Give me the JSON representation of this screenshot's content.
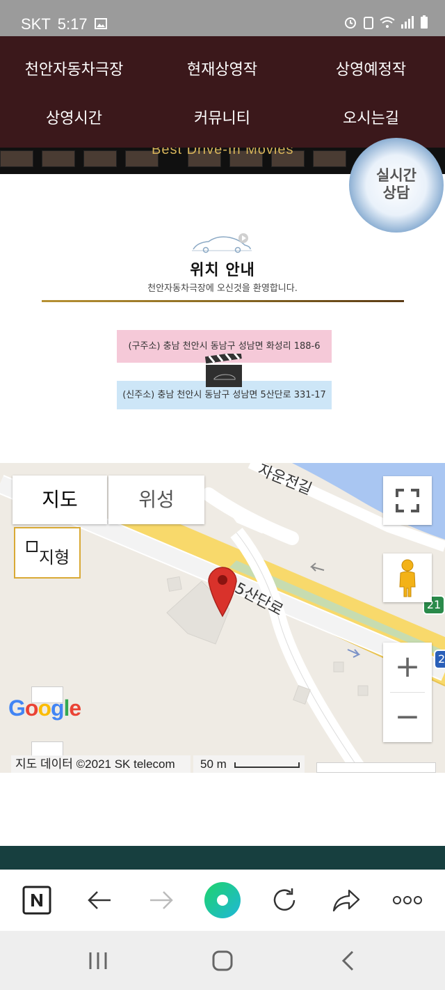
{
  "status_bar": {
    "carrier": "SKT",
    "time": "5:17"
  },
  "nav_menu": [
    {
      "label": "천안자동차극장"
    },
    {
      "label": "현재상영작"
    },
    {
      "label": "상영예정작"
    },
    {
      "label": "상영시간"
    },
    {
      "label": "커뮤니티"
    },
    {
      "label": "오시는길"
    }
  ],
  "hero": {
    "caption": "Best Drive-In Movies"
  },
  "chat_button": {
    "line1": "실시간",
    "line2": "상담"
  },
  "location": {
    "title": "위치 안내",
    "subtitle": "천안자동차극장에 오신것을 환영합니다.",
    "old_address": "(구주소) 충남 천안시 동남구 성남면 화성리 188-6",
    "new_address": "(신주소) 충남 천안시 동남구 성남면 5산단로 331-17"
  },
  "map": {
    "tab_map": "지도",
    "tab_satellite": "위성",
    "terrain_label": "지형",
    "road_label_1": "5산단로",
    "road_label_2": "자운전길",
    "route_badge": "21",
    "route_badge_2": "2",
    "zoom_in": "+",
    "zoom_out": "−",
    "attribution": "지도 데이터 ©2021 SK telecom",
    "scale": "50 m",
    "logo": "Google"
  },
  "browser_bar": {
    "icons": [
      "naver-home-icon",
      "back-arrow-icon",
      "forward-arrow-icon",
      "search-circle-icon",
      "reload-icon",
      "share-icon",
      "more-icon"
    ]
  },
  "android_nav": {
    "icons": [
      "recent-apps-icon",
      "home-icon",
      "back-icon"
    ]
  },
  "colors": {
    "nav_bg": "#3b181b",
    "status_bg": "#9b9b9b",
    "footer_band": "#173f3f",
    "old_addr_bg": "#f5c9d8",
    "new_addr_bg": "#cde6f7",
    "map_marker": "#d9322b",
    "naver_green": "#03c75a"
  }
}
